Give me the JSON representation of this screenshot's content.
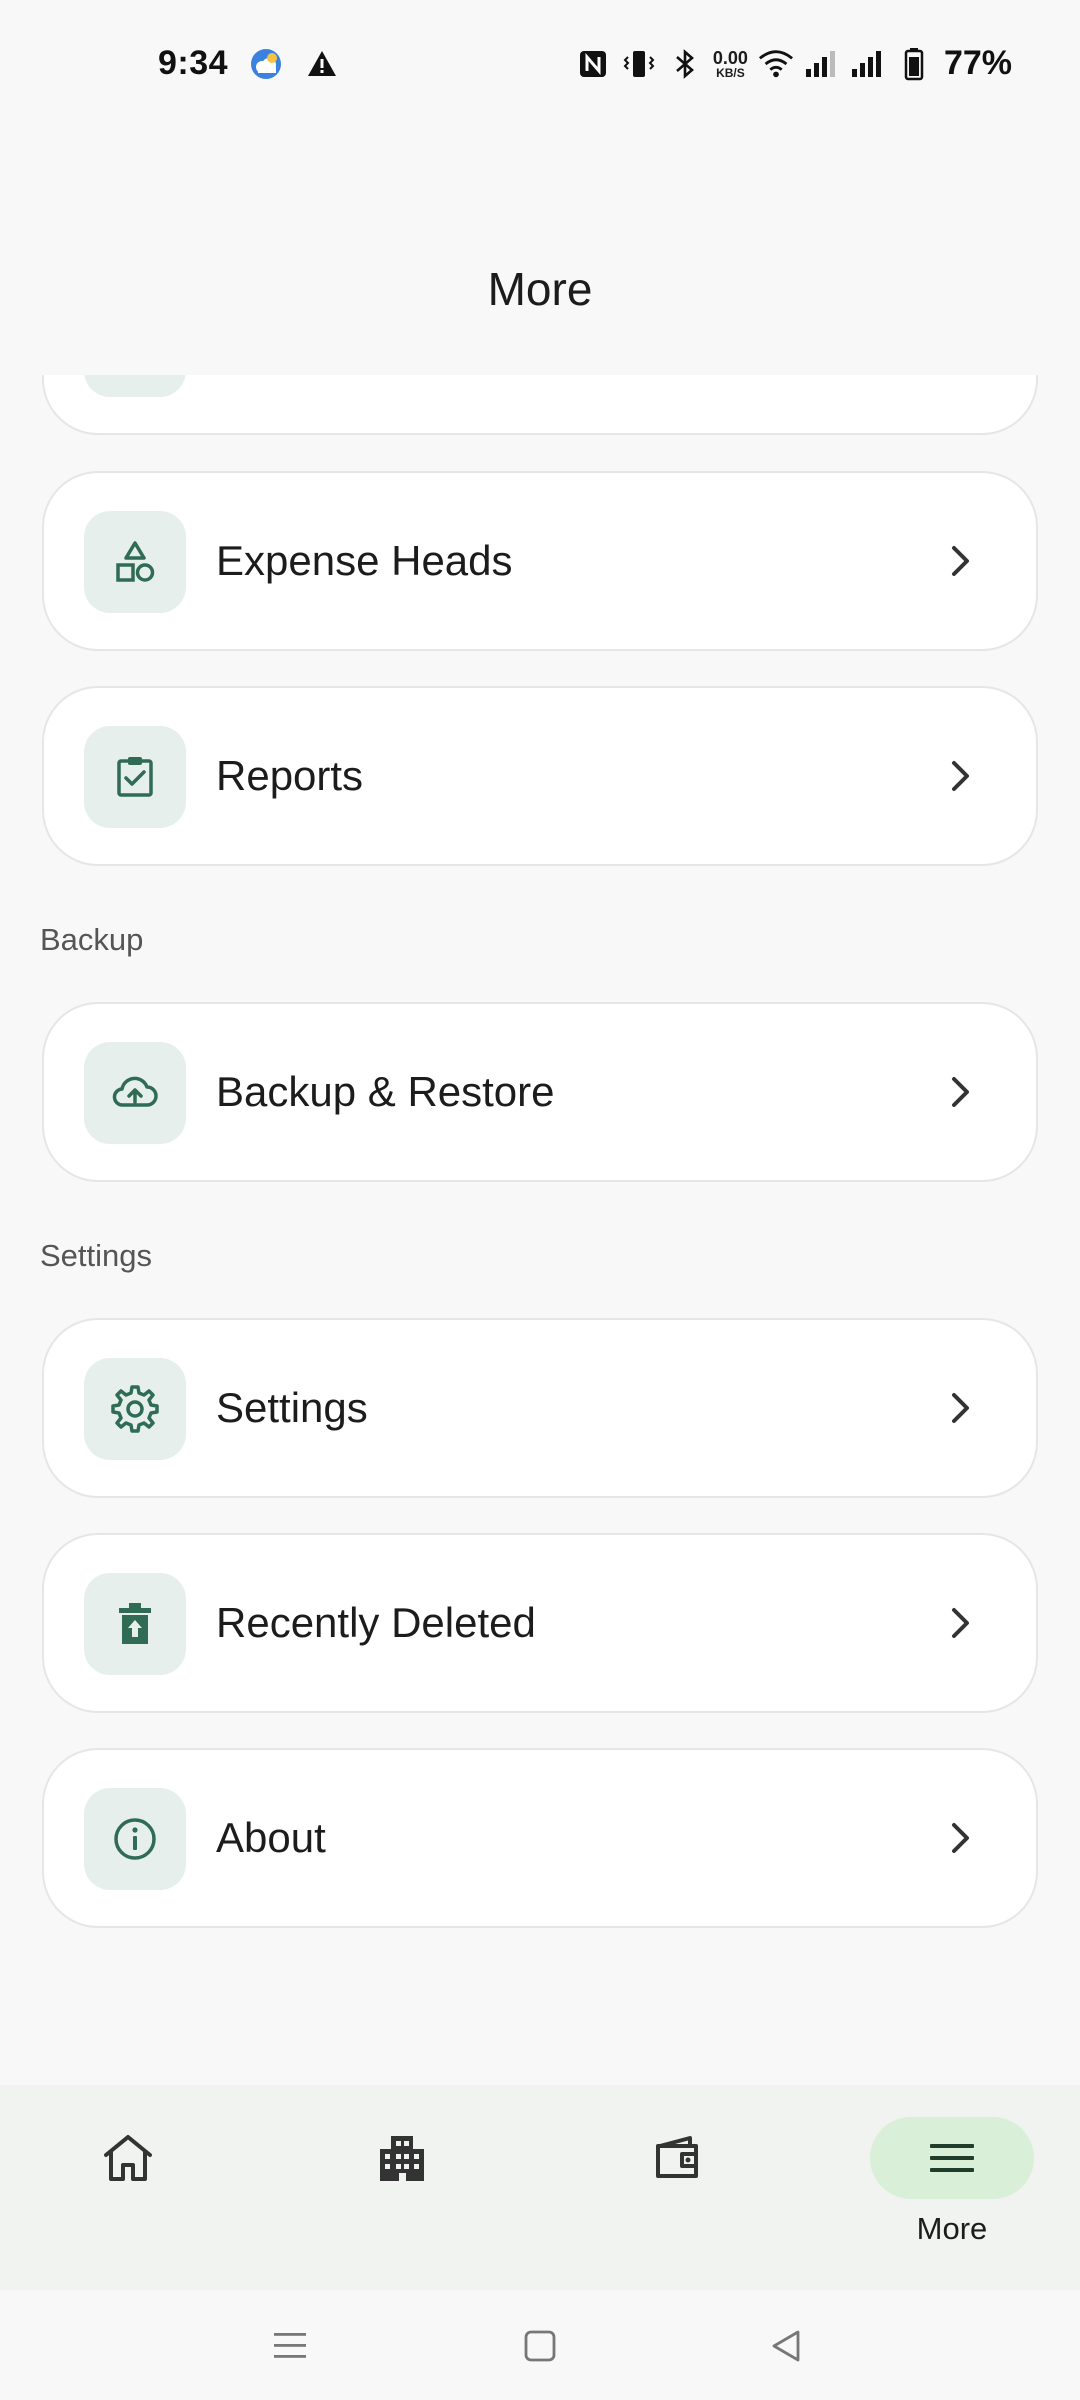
{
  "status_bar": {
    "time": "9:34",
    "net_speed_value": "0.00",
    "net_speed_unit": "KB/S",
    "battery": "77%",
    "icons": [
      "weather-icon",
      "alert-icon",
      "nfc-icon",
      "vibrate-icon",
      "bluetooth-icon",
      "wifi-icon",
      "signal-icon",
      "signal-icon",
      "battery-icon"
    ]
  },
  "header": {
    "title": "More"
  },
  "menu": {
    "items": [
      {
        "label": "Expense Heads",
        "icon": "shapes-icon"
      },
      {
        "label": "Reports",
        "icon": "clipboard-check-icon"
      },
      {
        "label": "Backup & Restore",
        "icon": "cloud-upload-icon"
      },
      {
        "label": "Settings",
        "icon": "gear-icon"
      },
      {
        "label": "Recently Deleted",
        "icon": "trash-restore-icon"
      },
      {
        "label": "About",
        "icon": "info-icon"
      }
    ],
    "sections": {
      "backup": "Backup",
      "settings": "Settings"
    }
  },
  "bottom_nav": {
    "items": [
      {
        "icon": "home-icon"
      },
      {
        "icon": "building-icon"
      },
      {
        "icon": "wallet-icon"
      },
      {
        "icon": "menu-icon",
        "label": "More",
        "active": true
      }
    ]
  },
  "colors": {
    "accent": "#2f6b55",
    "icon_bg": "#e7efec",
    "nav_active_bg": "#d9efd8",
    "nav_bg": "#f0f3ef"
  }
}
